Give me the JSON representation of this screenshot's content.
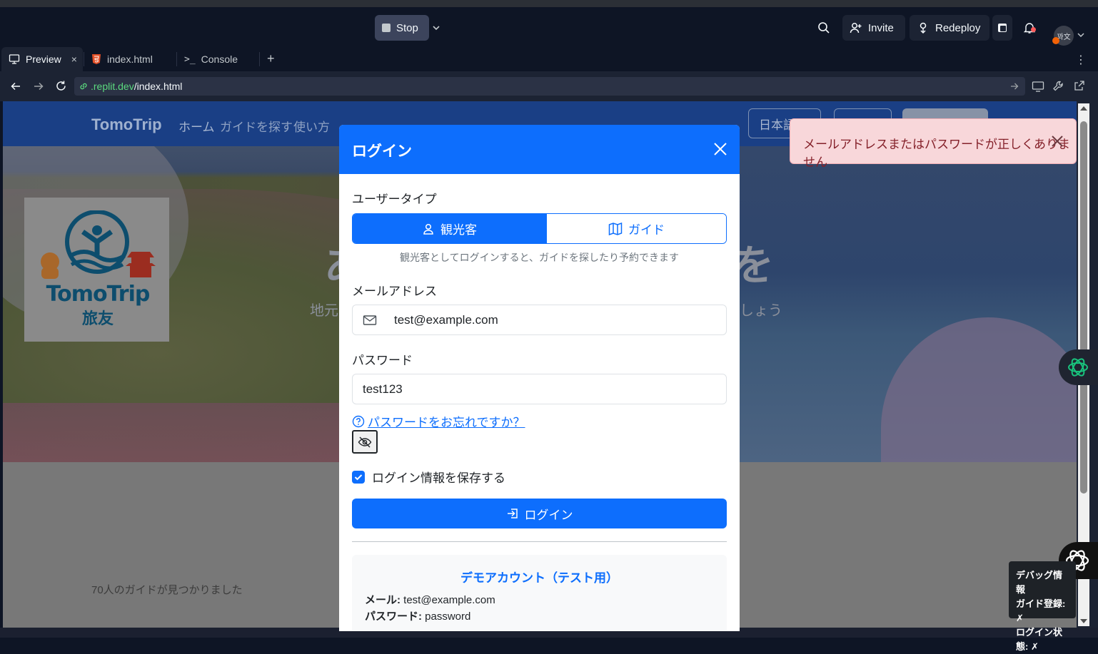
{
  "topbar": {
    "stop_label": "Stop",
    "invite_label": "Invite",
    "redeploy_label": "Redeploy",
    "avatar_initials": "꽈文"
  },
  "tabs": [
    {
      "label": "Preview",
      "icon": "monitor-icon"
    },
    {
      "label": "index.html",
      "icon": "html5-icon"
    },
    {
      "label": "Console",
      "icon": "terminal-icon"
    }
  ],
  "url": {
    "host": ".replit.dev",
    "path": "/index.html"
  },
  "site": {
    "brand": "TomoTrip",
    "nav": [
      "ホーム",
      "ガイドを探す",
      "使い方"
    ],
    "lang_button": "日本語",
    "hero_title_left": "あ",
    "hero_title_right": "を",
    "hero_sub_left": "地元",
    "hero_sub_right": "しょう",
    "logo_text": "TomoTrip",
    "logo_kanji": "旅友",
    "results_text": "70人のガイドが見つかりました"
  },
  "modal": {
    "title": "ログイン",
    "user_type_label": "ユーザータイプ",
    "tourist_label": "観光客",
    "guide_label": "ガイド",
    "hint": "観光客としてログインすると、ガイドを探したり予約できます",
    "email_label": "メールアドレス",
    "email_value": "test@example.com",
    "password_label": "パスワード",
    "password_value": "test123",
    "forgot_label": "パスワードをお忘れですか？",
    "remember_label": "ログイン情報を保存する",
    "login_label": "ログイン",
    "demo_title": "デモアカウント（テスト用）",
    "demo_mail_key": "メール:",
    "demo_mail_value": " test@example.com",
    "demo_pw_key": "パスワード:",
    "demo_pw_value": " password"
  },
  "toast": {
    "text": "メールアドレスまたはパスワードが正しくありません"
  },
  "debug": {
    "title": "デバッグ情報",
    "line1": "ガイド登録: ✗",
    "line2": "ログイン状態: ✗"
  },
  "colors": {
    "primary": "#0d6efd",
    "error_bg": "#f8d7da",
    "error_text": "#842029",
    "replit_bg": "#0e1525"
  }
}
